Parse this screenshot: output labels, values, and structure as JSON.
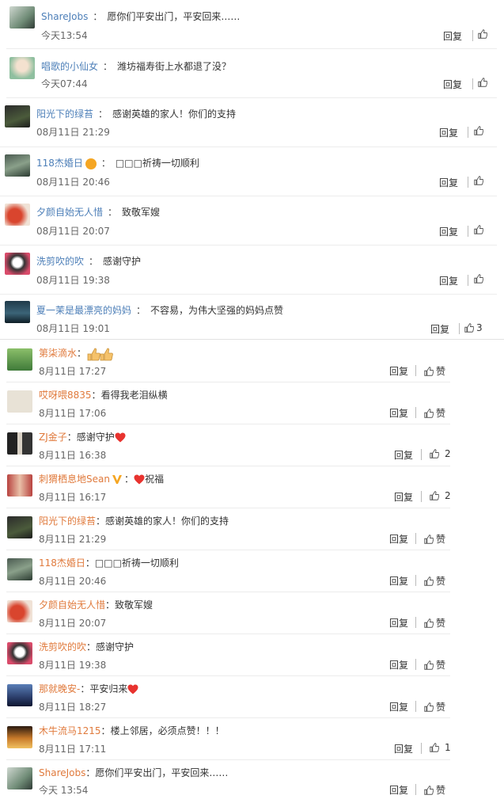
{
  "reply_label": "回复",
  "like_label": "赞",
  "comments": [
    {
      "name": "ShareJobs",
      "sep": "：",
      "text": "愿你们平安出门，平安回来……",
      "time": "今天13:54",
      "likes": ""
    },
    {
      "name": "唱歌的小仙女",
      "sep": "：",
      "text": "潍坊福寿街上水都退了没？",
      "time": "今天07:44",
      "likes": ""
    },
    {
      "name": "阳光下的绿苔",
      "sep": "：",
      "text": "感谢英雄的家人！你们的支持",
      "time": "08月11日 21:29",
      "likes": ""
    },
    {
      "name": "118杰婚日",
      "sep": "：",
      "text": "□□□祈祷一切顺利",
      "time": "08月11日 20:46",
      "likes": ""
    },
    {
      "name": "夕颜自始无人惜",
      "sep": "：",
      "text": "致敬军嫂",
      "time": "08月11日 20:07",
      "likes": ""
    },
    {
      "name": "洗剪吹的吹",
      "sep": "：",
      "text": "感谢守护",
      "time": "08月11日 19:38",
      "likes": ""
    },
    {
      "name": "夏一茉是最漂亮的妈妈",
      "sep": "：",
      "text": "不容易，为伟大坚强的妈妈点赞",
      "time": "08月11日 19:01",
      "likes": "3"
    },
    {
      "name": "第柒滴水",
      "sep": "：",
      "text": "",
      "time": "8月11日 17:27",
      "likes": "赞"
    },
    {
      "name": "哎呀喂8835",
      "sep": "：",
      "text": "看得我老泪纵横",
      "time": "8月11日 17:06",
      "likes": "赞"
    },
    {
      "name": "ZJ金子",
      "sep": "：",
      "text": "感谢守护",
      "time": "8月11日 16:38",
      "likes": "2"
    },
    {
      "name": "刺猬栖息地Sean",
      "sep": "：",
      "text": "祝福",
      "time": "8月11日 16:17",
      "likes": "2"
    },
    {
      "name": "阳光下的绿苔",
      "sep": "：",
      "text": "感谢英雄的家人！你们的支持",
      "time": "8月11日 21:29",
      "likes": "赞"
    },
    {
      "name": "118杰婚日",
      "sep": "：",
      "text": "□□□祈祷一切顺利",
      "time": "8月11日 20:46",
      "likes": "赞"
    },
    {
      "name": "夕颜自始无人惜",
      "sep": "：",
      "text": "致敬军嫂",
      "time": "8月11日 20:07",
      "likes": "赞"
    },
    {
      "name": "洗剪吹的吹",
      "sep": "：",
      "text": "感谢守护",
      "time": "8月11日 19:38",
      "likes": "赞"
    },
    {
      "name": "那就晚安-",
      "sep": "：",
      "text": "平安归来",
      "time": "8月11日 18:27",
      "likes": "赞"
    },
    {
      "name": "木牛流马1215",
      "sep": "：",
      "text": "楼上邻居，必须点赞！！！",
      "time": "8月11日 17:11",
      "likes": "1"
    },
    {
      "name": "ShareJobs",
      "sep": "：",
      "text": "愿你们平安出门，平安回来……",
      "time": "今天 13:54",
      "likes": "赞"
    }
  ],
  "colors": {
    "name_blue": "#4d7fb8",
    "name_orange": "#e07a3c",
    "heart": "#e8332f",
    "badge": "#f5a623"
  }
}
